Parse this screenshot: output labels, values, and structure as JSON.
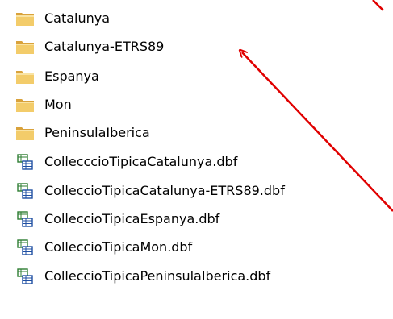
{
  "items": [
    {
      "name": "Catalunya",
      "type": "folder"
    },
    {
      "name": "Catalunya-ETRS89",
      "type": "folder"
    },
    {
      "name": "Espanya",
      "type": "folder"
    },
    {
      "name": "Mon",
      "type": "folder"
    },
    {
      "name": "PeninsulaIberica",
      "type": "folder"
    },
    {
      "name": "CollecccioTipicaCatalunya.dbf",
      "type": "dbf-file"
    },
    {
      "name": "ColleccioTipicaCatalunya-ETRS89.dbf",
      "type": "dbf-file"
    },
    {
      "name": "ColleccioTipicaEspanya.dbf",
      "type": "dbf-file"
    },
    {
      "name": "ColleccioTipicaMon.dbf",
      "type": "dbf-file"
    },
    {
      "name": "ColleccioTipicaPeninsulaIberica.dbf",
      "type": "dbf-file"
    }
  ],
  "annotation_color": "#e00000"
}
